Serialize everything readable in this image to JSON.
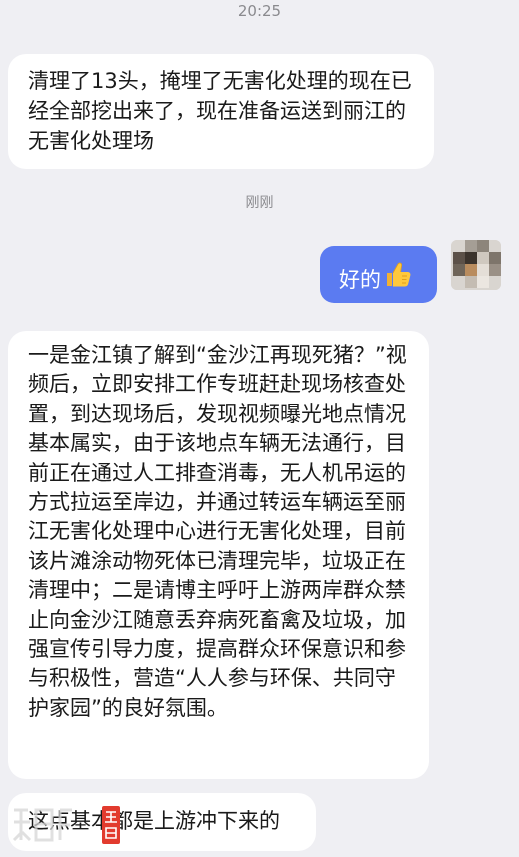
{
  "timestamps": {
    "top": "20:25",
    "middle": "刚刚"
  },
  "messages": [
    {
      "side": "left",
      "text": "清理了13头，掩埋了无害化处理的现在已经全部挖出来了，现在准备运送到丽江的无害化处理场"
    },
    {
      "side": "right",
      "text": "好的",
      "emoji": "thumbs-up"
    },
    {
      "side": "left",
      "text": "一是金江镇了解到“金沙江再现死猪？”视频后，立即安排工作专班赶赴现场核查处置，到达现场后，发现视频曝光地点情况基本属实，由于该地点车辆无法通行，目前正在通过人工排查消毒，无人机吊运的方式拉运至岸边，并通过转运车辆运至丽江无害化处理中心进行无害化处理，目前该片滩涂动物死体已清理完毕，垃圾正在清理中；二是请博主呼吁上游两岸群众禁止向金沙江随意丢弃病死畜禽及垃圾，加强宣传引导力度，提高群众环保意识和参与积极性，营造“人人参与环保、共同守护家园”的良好氛围。"
    },
    {
      "side": "left",
      "text": "这点基本都是上游冲下来的"
    }
  ],
  "colors": {
    "background": "#efeff3",
    "incoming_bubble": "#ffffff",
    "outgoing_bubble": "#5b7bf1",
    "timestamp": "#8a8a8e"
  },
  "icons": {
    "outgoing_emoji": "thumbs-up-icon",
    "avatar": "avatar",
    "watermark": "news-watermark"
  }
}
